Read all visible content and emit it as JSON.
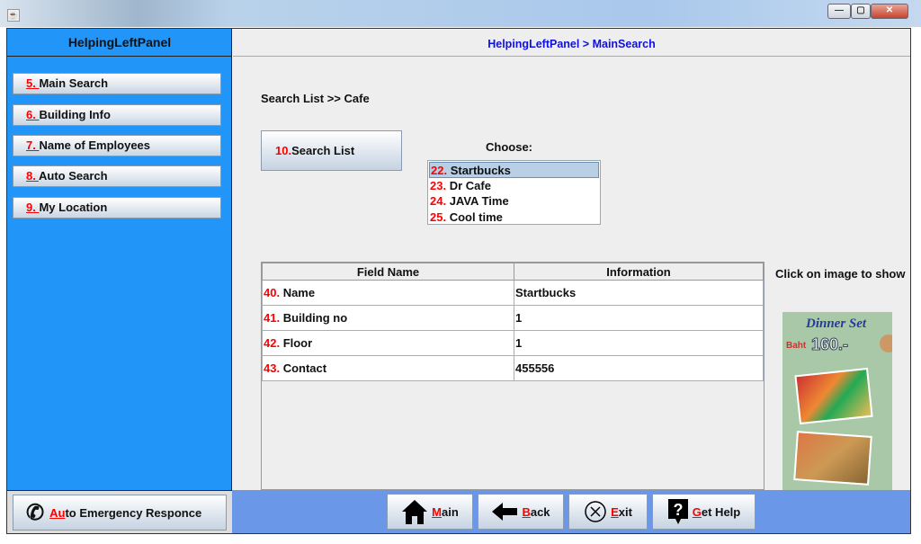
{
  "left_panel": {
    "title": "HelpingLeftPanel",
    "items": [
      {
        "num": "5. ",
        "label": "Main Search"
      },
      {
        "num": "6. ",
        "label": "Building Info"
      },
      {
        "num": "7. ",
        "label": "Name of Employees"
      },
      {
        "num": "8. ",
        "label": "Auto Search"
      },
      {
        "num": "9. ",
        "label": "My Location"
      }
    ],
    "emergency": {
      "mnemonic": "Au",
      "rest": "to Emergency Responce"
    }
  },
  "header": {
    "breadcrumb": "HelpingLeftPanel > MainSearch"
  },
  "main": {
    "path_label": "Search List >> Cafe",
    "search_button": {
      "num": "10.",
      "label": "Search List"
    },
    "choose_label": "Choose:",
    "options": [
      {
        "num": "22.",
        "label": " Startbucks",
        "selected": true
      },
      {
        "num": "23.",
        "label": " Dr Cafe"
      },
      {
        "num": "24.",
        "label": " JAVA Time"
      },
      {
        "num": "25.",
        "label": " Cool time"
      }
    ],
    "table": {
      "headers": [
        "Field Name",
        "Information"
      ],
      "rows": [
        {
          "num": "40.",
          "field": " Name",
          "value": "Startbucks"
        },
        {
          "num": "41.",
          "field": " Building no",
          "value": "1"
        },
        {
          "num": "42.",
          "field": " Floor",
          "value": "1"
        },
        {
          "num": "43.",
          "field": " Contact",
          "value": "455556"
        }
      ]
    },
    "image_hint": "Click on image to show",
    "image": {
      "title": "Dinner Set",
      "currency": "Baht",
      "price": "160.-"
    }
  },
  "bottom": {
    "buttons": [
      {
        "mnemonic": "M",
        "rest": "ain"
      },
      {
        "mnemonic": "B",
        "rest": "ack"
      },
      {
        "mnemonic": "E",
        "rest": "xit"
      },
      {
        "mnemonic": "G",
        "rest": "et Help"
      }
    ]
  }
}
